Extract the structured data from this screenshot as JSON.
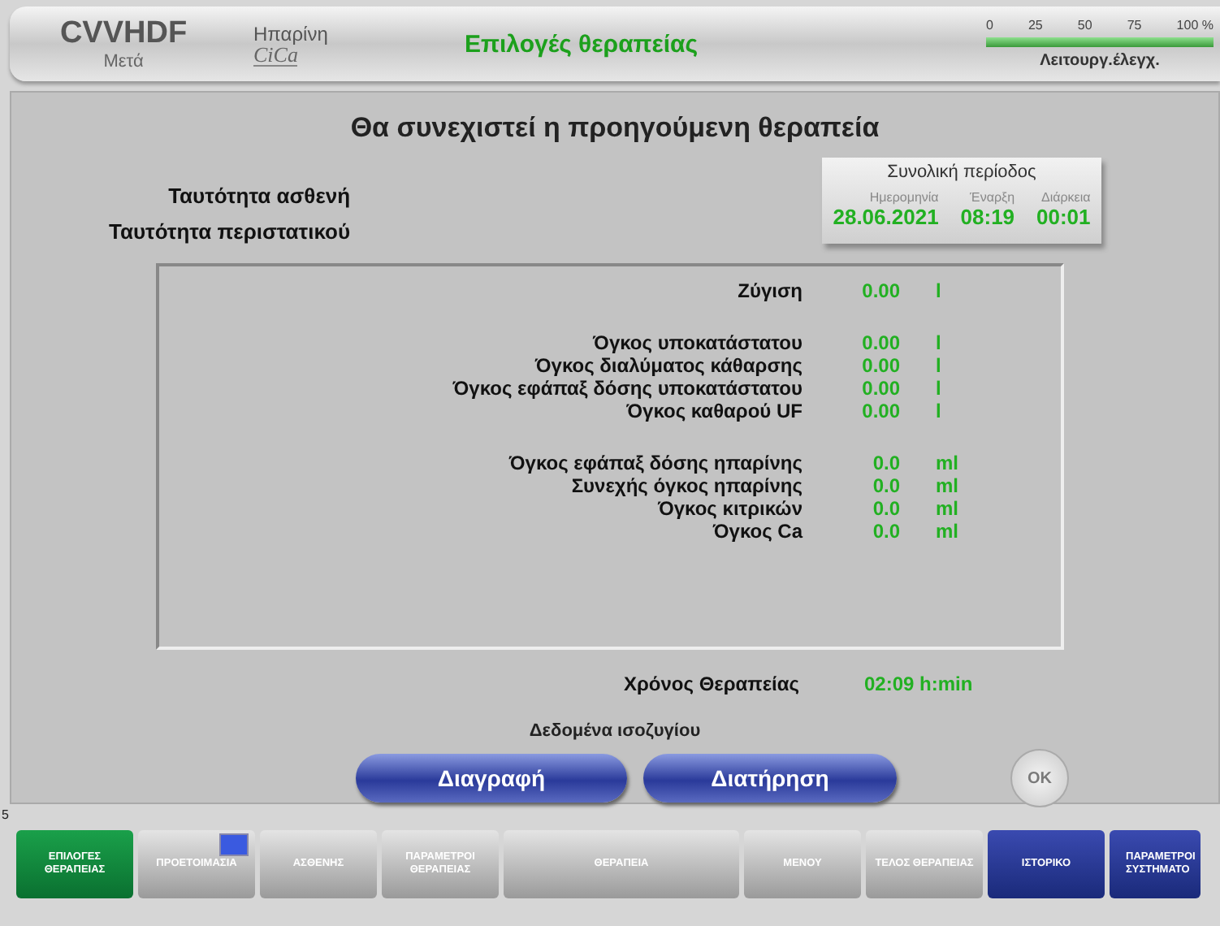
{
  "header": {
    "mode": "CVVHDF",
    "phase": "Μετά",
    "anticoagulation": "Ηπαρίνη",
    "anticoagulation_logo": "CiCa",
    "title": "Επιλογές θεραπείας",
    "progress": {
      "ticks": [
        "0",
        "25",
        "50",
        "75",
        "100 %"
      ],
      "level": 1,
      "label": "Λειτουργ.έλεγχ."
    }
  },
  "main": {
    "heading": "Θα συνεχιστεί η προηγούμενη θεραπεία",
    "patient_labels": [
      "Ταυτότητα ασθενή",
      "Ταυτότητα περιστατικού"
    ],
    "period": {
      "title": "Συνολική περίοδος",
      "columns": [
        {
          "label": "Ημερομηνία",
          "value": "28.06.2021"
        },
        {
          "label": "Έναρξη",
          "value": "08:19"
        },
        {
          "label": "Διάρκεια",
          "value": "00:01"
        }
      ]
    },
    "balance_groups": [
      [
        {
          "label": "Ζύγιση",
          "value": "0.00",
          "unit": "l"
        }
      ],
      [
        {
          "label": "Όγκος υποκατάστατου",
          "value": "0.00",
          "unit": "l"
        },
        {
          "label": "Όγκος διαλύματος κάθαρσης",
          "value": "0.00",
          "unit": "l"
        },
        {
          "label": "Όγκος εφάπαξ δόσης υποκατάστατου",
          "value": "0.00",
          "unit": "l"
        },
        {
          "label": "Όγκος καθαρού UF",
          "value": "0.00",
          "unit": "l"
        }
      ],
      [
        {
          "label": "Όγκος εφάπαξ δόσης ηπαρίνης",
          "value": "0.0",
          "unit": "ml"
        },
        {
          "label": "Συνεχής όγκος ηπαρίνης",
          "value": "0.0",
          "unit": "ml"
        },
        {
          "label": "Όγκος κιτρικών",
          "value": "0.0",
          "unit": "ml"
        },
        {
          "label": "Όγκος Ca",
          "value": "0.0",
          "unit": "ml"
        }
      ]
    ],
    "therapy_time": {
      "label": "Χρόνος Θεραπείας",
      "value": "02:09 h:min"
    },
    "balance_data_label": "Δεδομένα ισοζυγίου",
    "buttons": [
      {
        "label": "Διαγραφή",
        "disabled": false
      },
      {
        "label": "Διατήρηση",
        "disabled": false
      }
    ],
    "ok_button": {
      "label": "OK",
      "disabled": true
    }
  },
  "side_mark": "5",
  "nav": [
    {
      "label": "ΕΠΙΛΟΓΕΣ ΘΕΡΑΠΕΙΑΣ",
      "kind": "standard",
      "selected": true,
      "badge": false
    },
    {
      "label": "ΠΡΟΕΤΟΙΜΑΣΙΑ",
      "kind": "standard",
      "selected": false,
      "badge": true
    },
    {
      "label": "ΑΣΘΕΝΗΣ",
      "kind": "standard",
      "selected": false,
      "badge": false
    },
    {
      "label": "ΠΑΡΑΜΕΤΡΟΙ ΘΕΡΑΠΕΙΑΣ",
      "kind": "standard",
      "selected": false,
      "badge": false
    },
    {
      "label": "ΘΕΡΑΠΕΙΑ",
      "kind": "wide",
      "selected": false,
      "badge": false
    },
    {
      "label": "ΜΕΝΟΥ",
      "kind": "standard",
      "selected": false,
      "badge": false
    },
    {
      "label": "ΤΕΛΟΣ ΘΕΡΑΠΕΙΑΣ",
      "kind": "standard",
      "selected": false,
      "badge": false
    },
    {
      "label": "ΙΣΤΟΡΙΚΟ",
      "kind": "system",
      "selected": false,
      "badge": false
    },
    {
      "label": "ΠΑΡΑΜΕΤΡΟΙ ΣΥΣΤΗΜΑΤΟ",
      "kind": "system",
      "selected": false,
      "badge": false
    }
  ]
}
